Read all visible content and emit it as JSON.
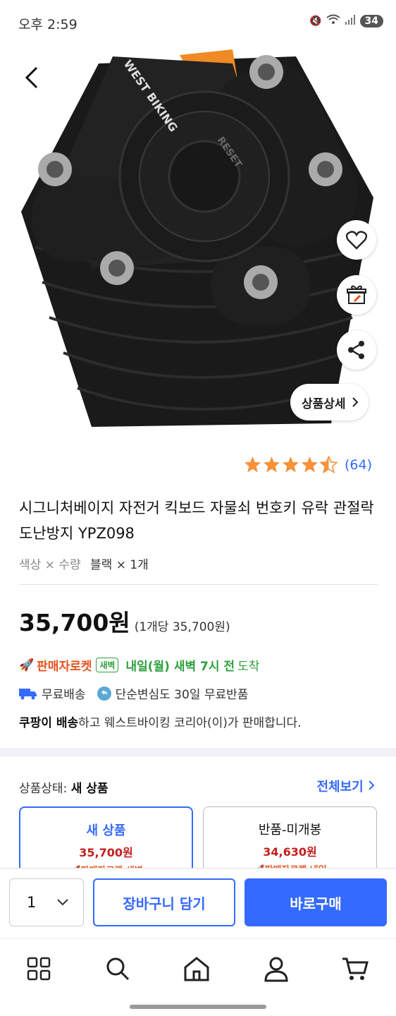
{
  "status": {
    "time": "오후 2:59",
    "battery": "34"
  },
  "product": {
    "image_brand": "WEST BIKING",
    "image_label": "RESET",
    "detail_button": "상품상세",
    "rating": 4.5,
    "review_count": "(64)",
    "title": "시그니처베이지 자전거 킥보드 자물쇠 번호키 유락 관절락 도난방지 YPZ098",
    "option_label": "색상 × 수량",
    "option_value": "블랙 × 1개",
    "price": "35,700원",
    "unit_price": "(1개당 35,700원)",
    "rocket": "판매자로켓",
    "dawn_badge": "새벽",
    "arrival_bold": "내일(월) 새벽 7시 전",
    "arrival_suffix": "도착",
    "free_shipping": "무료배송",
    "free_return": "단순변심도 30일 무료반품",
    "seller_bold": "쿠팡이 배송",
    "seller_text": "하고 웨스트바이킹 코리아(이)가 판매합니다."
  },
  "condition": {
    "label": "상품상태:",
    "value": "새 상품",
    "view_all": "전체보기",
    "cards": [
      {
        "name": "새 상품",
        "price": "35,700원",
        "rocket": "🚀판매자로켓 새벽"
      },
      {
        "name": "반품-미개봉",
        "price": "34,630원",
        "rocket": "🚀판매자로켓 내일"
      }
    ]
  },
  "buybar": {
    "quantity": "1",
    "cart": "장바구니 담기",
    "buy": "바로구매"
  },
  "colors": {
    "accent": "#346aff",
    "rocket": "#e8511d",
    "green": "#2d9f3d",
    "price_red": "#c41e1e",
    "star": "#f7913a"
  }
}
